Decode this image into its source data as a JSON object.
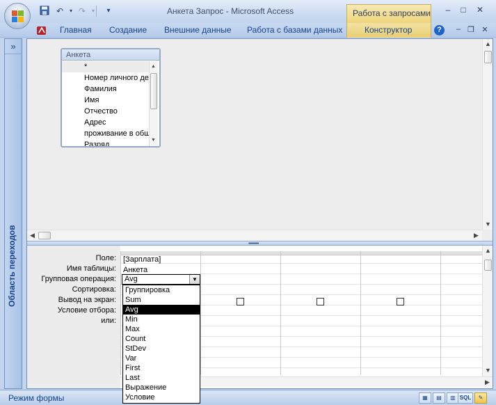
{
  "window": {
    "title": "Анкета Запрос - Microsoft Access",
    "context_tab": "Работа с запросами"
  },
  "ribbon": {
    "tabs": [
      "Главная",
      "Создание",
      "Внешние данные",
      "Работа с базами данных"
    ],
    "context_tab": "Конструктор"
  },
  "navigation_pane": {
    "toggle": "»",
    "label": "Область переходов"
  },
  "table": {
    "name": "Анкета",
    "fields": [
      "*",
      "Номер личного дела",
      "Фамилия",
      "Имя",
      "Отчество",
      "Адрес",
      "проживание в общежитии",
      "Разряд"
    ]
  },
  "design_grid": {
    "row_labels": [
      "Поле:",
      "Имя таблицы:",
      "Групповая операция:",
      "Сортировка:",
      "Вывод на экран:",
      "Условие отбора:",
      "или:"
    ],
    "columns": [
      {
        "field": "[Зарплата]",
        "table": "Анкета",
        "total": "Avg",
        "show": true
      },
      {
        "field": "",
        "table": "",
        "total": "",
        "show": false
      },
      {
        "field": "",
        "table": "",
        "total": "",
        "show": false
      },
      {
        "field": "",
        "table": "",
        "total": "",
        "show": false
      }
    ]
  },
  "dropdown": {
    "options": [
      "Группировка",
      "Sum",
      "Avg",
      "Min",
      "Max",
      "Count",
      "StDev",
      "Var",
      "First",
      "Last",
      "Выражение",
      "Условие"
    ],
    "selected": "Avg"
  },
  "statusbar": {
    "text": "Режим формы",
    "views": [
      "form-view",
      "pivot-table-view",
      "pivot-chart-view",
      "SQL",
      "design-view"
    ],
    "active_view": "design-view"
  }
}
